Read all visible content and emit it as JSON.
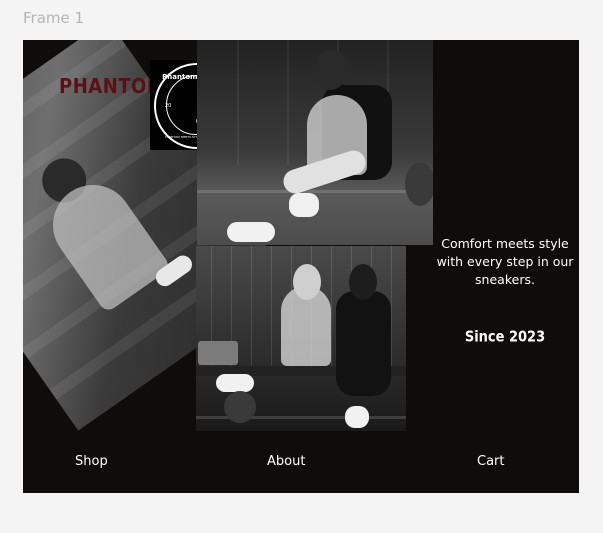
{
  "frame": {
    "label": "Frame 1"
  },
  "brand": {
    "title": "PHANTOM",
    "logo": {
      "name": "Phantom Trainers",
      "year_left": "20",
      "year_right": "23",
      "motto": "COMFORT MEETS STYLE WITH EVERY STEP",
      "icon": "winged-sneaker-icon"
    }
  },
  "content": {
    "tagline": "Comfort meets style with every step in  our sneakers.",
    "since": "Since 2023"
  },
  "nav": {
    "shop": "Shop",
    "about": "About",
    "cart": "Cart"
  },
  "colors": {
    "page_bg": "#f4f4f4",
    "frame_bg": "#0f0c0c",
    "title_red": "#5b1114",
    "text_white": "#ffffff"
  }
}
